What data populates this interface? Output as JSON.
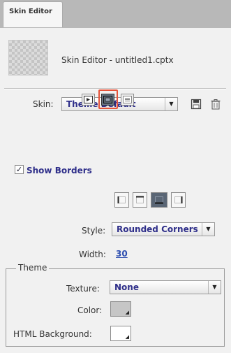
{
  "tab": {
    "label": "Skin Editor"
  },
  "header": {
    "doc_title": "Skin Editor - untitled1.cptx"
  },
  "skin": {
    "label": "Skin:",
    "selected": "Theme Default"
  },
  "show_borders": {
    "label": "Show Borders",
    "checked": true
  },
  "border": {
    "style_label": "Style:",
    "style_selected": "Rounded Corners",
    "width_label": "Width:",
    "width_value": "30"
  },
  "theme": {
    "legend": "Theme",
    "texture_label": "Texture:",
    "texture_selected": "None",
    "color_label": "Color:",
    "html_bg_label": "HTML Background:"
  },
  "colors": {
    "tabstrip": "#b8b8b8",
    "panel": "#f1f1f1",
    "accent_text": "#2f2f8a",
    "highlight_ring": "#e5533a",
    "active_button": "#6a7686"
  },
  "icons": [
    "save-icon",
    "trash-icon",
    "playbar-icon",
    "borders-icon",
    "toc-icon",
    "border-left-icon",
    "border-top-icon",
    "border-bottom-icon",
    "border-right-icon"
  ]
}
